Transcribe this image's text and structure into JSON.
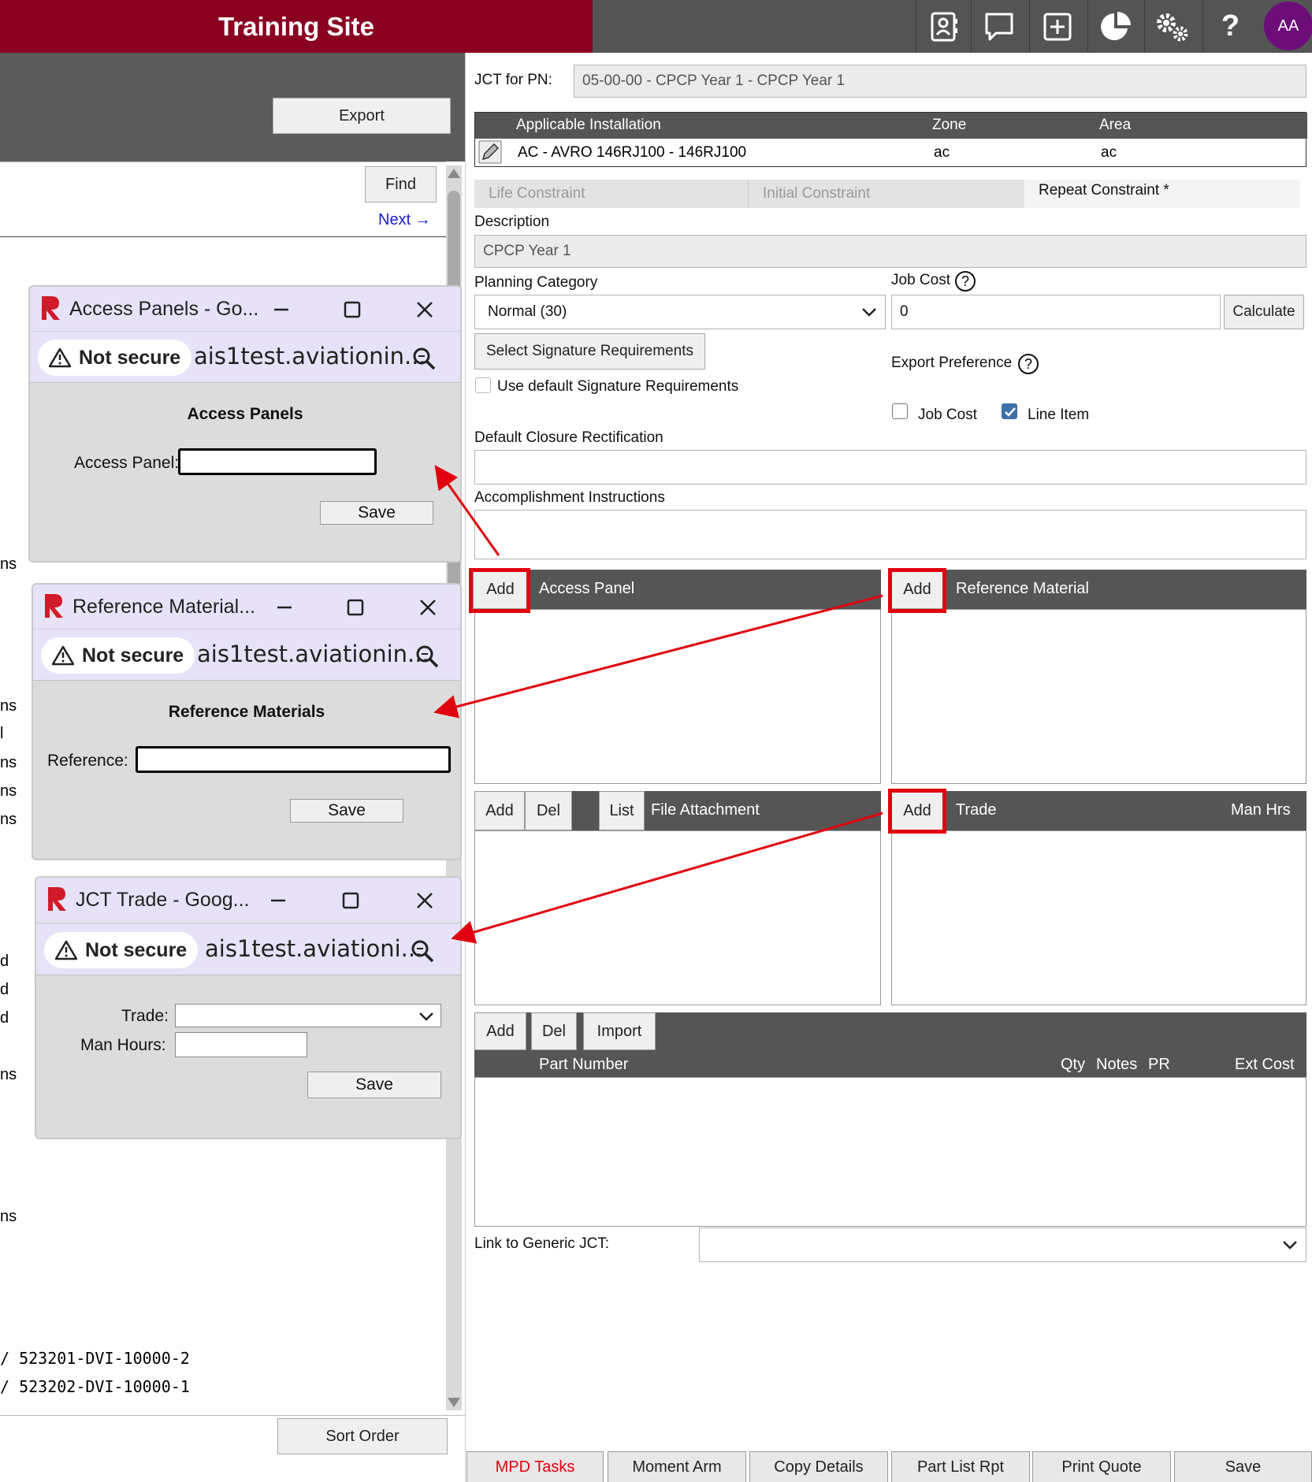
{
  "header": {
    "title": "Training Site",
    "avatar": "AA",
    "icons": [
      "contact-card-icon",
      "chat-icon",
      "add-square-icon",
      "pie-chart-icon",
      "settings-gears-icon",
      "help-icon"
    ]
  },
  "left": {
    "export_label": "Export",
    "find_label": "Find",
    "next_label": "Next →",
    "sort_order_label": "Sort Order",
    "fragments": [
      "ns",
      "ns",
      "l",
      "ns",
      "ns",
      "ns",
      "d",
      "d",
      "d",
      "ns",
      "ns"
    ],
    "refs": [
      "/ 523201-DVI-10000-2",
      "/ 523202-DVI-10000-1"
    ]
  },
  "popups": {
    "not_secure": "Not secure",
    "access": {
      "title": "Access Panels - Go...",
      "url": "ais1test.aviationin...",
      "heading": "Access Panels",
      "field_label": "Access Panel:",
      "field_value": "",
      "save": "Save"
    },
    "reference": {
      "title": "Reference Material...",
      "url": "ais1test.aviationin...",
      "heading": "Reference Materials",
      "field_label": "Reference:",
      "field_value": "",
      "save": "Save"
    },
    "trade": {
      "title": "JCT Trade - Goog...",
      "url": "ais1test.aviationi...",
      "trade_label": "Trade:",
      "trade_value": "",
      "man_hours_label": "Man Hours:",
      "man_hours_value": "",
      "save": "Save"
    }
  },
  "form": {
    "jct_label": "JCT for PN:",
    "jct_value": "05-00-00 - CPCP Year 1 - CPCP Year 1",
    "install_headers": [
      "Applicable Installation",
      "Zone",
      "Area"
    ],
    "install_row": {
      "name": "AC - AVRO 146RJ100 - 146RJ100",
      "zone": "ac",
      "area": "ac"
    },
    "tabs": [
      "Life Constraint",
      "Initial Constraint",
      "Repeat Constraint *"
    ],
    "description_label": "Description",
    "description_value": "CPCP Year 1",
    "planning_label": "Planning Category",
    "planning_value": "Normal (30)",
    "job_cost_label": "Job Cost",
    "job_cost_value": "0",
    "calculate_label": "Calculate",
    "select_sig_label": "Select Signature Requirements",
    "use_default_sig_label": "Use default Signature Requirements",
    "export_pref_label": "Export Preference",
    "export_job_cost_label": "Job Cost",
    "export_line_item_label": "Line Item",
    "default_closure_label": "Default Closure Rectification",
    "default_closure_value": "",
    "accomplishment_label": "Accomplishment Instructions",
    "accomplishment_value": "",
    "access_panel_section": {
      "add": "Add",
      "title": "Access Panel"
    },
    "reference_section": {
      "add": "Add",
      "title": "Reference Material"
    },
    "file_section": {
      "add": "Add",
      "del": "Del",
      "list": "List",
      "title": "File Attachment"
    },
    "trade_section": {
      "add": "Add",
      "title": "Trade",
      "right": "Man Hrs"
    },
    "parts_section": {
      "add": "Add",
      "del": "Del",
      "import": "Import",
      "part_number": "Part Number",
      "qty": "Qty",
      "notes": "Notes",
      "pr": "PR",
      "ext_cost": "Ext Cost"
    },
    "link_generic_label": "Link to Generic JCT:",
    "link_generic_value": ""
  },
  "bottom_tabs": [
    "MPD Tasks",
    "Moment Arm",
    "Copy Details",
    "Part List Rpt",
    "Print Quote",
    "Save"
  ],
  "colors": {
    "brand": "#8a0020",
    "annotation": "#e0000f",
    "avatar": "#6d0d7a",
    "active_tab_text": "#e0000f"
  }
}
